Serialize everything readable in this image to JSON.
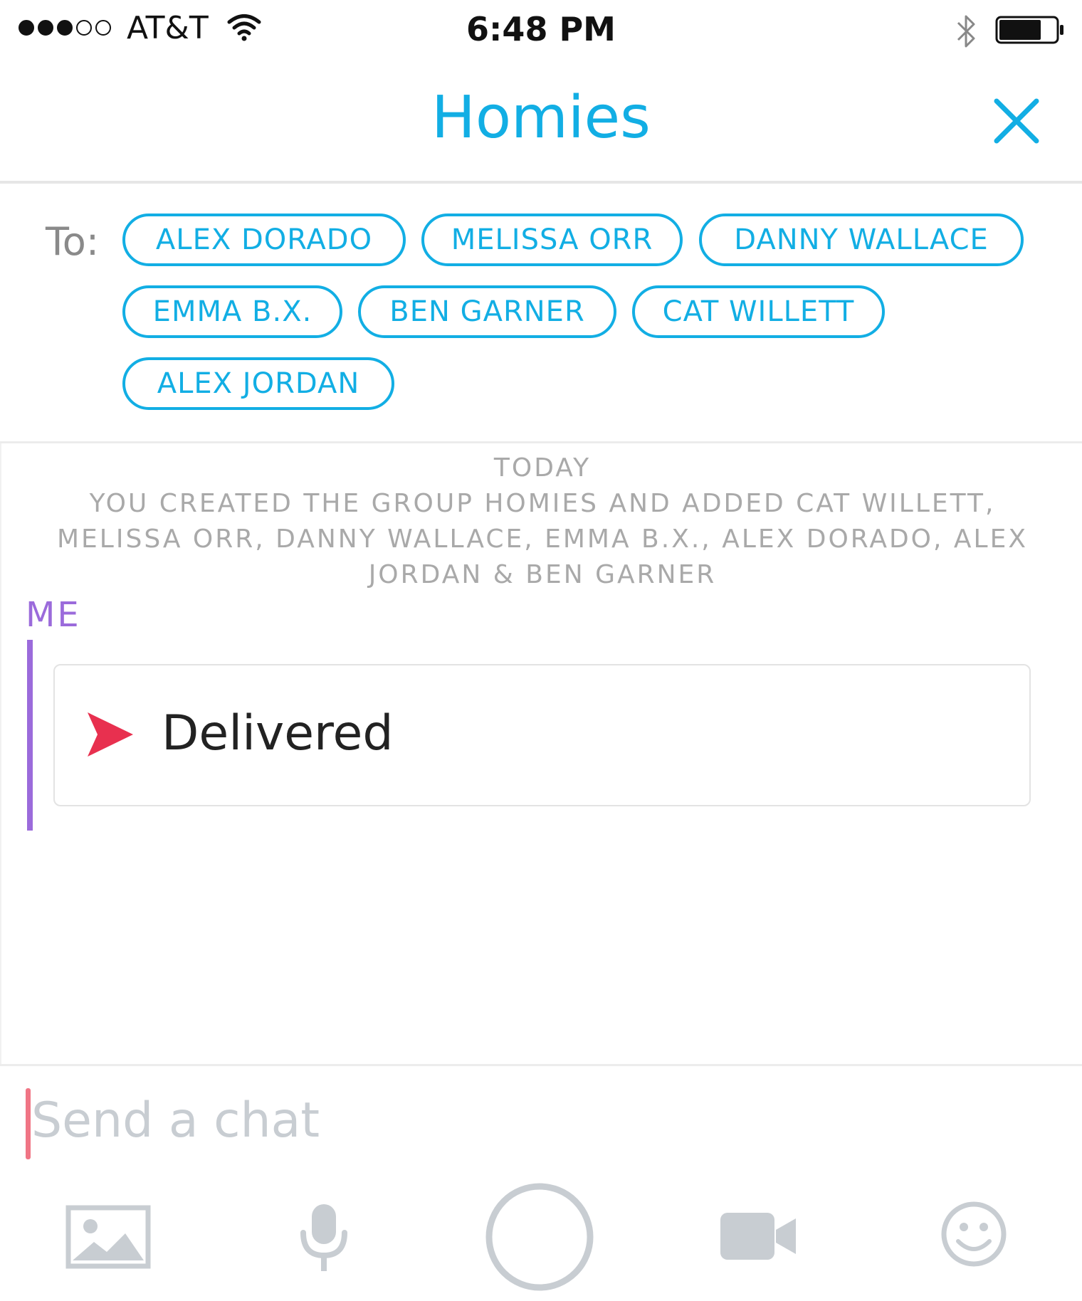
{
  "status_bar": {
    "carrier": "AT&T",
    "time": "6:48 PM",
    "signal_strength": 3,
    "signal_max": 5
  },
  "header": {
    "title": "Homies",
    "close_icon": "close-icon"
  },
  "recipients": {
    "label": "To:",
    "chips": [
      "ALEX DORADO",
      "MELISSA ORR",
      "DANNY WALLACE",
      "EMMA B.X.",
      "BEN GARNER",
      "CAT WILLETT",
      "ALEX JORDAN"
    ]
  },
  "chat": {
    "system_message": {
      "line1": "TODAY",
      "line2": "YOU CREATED THE GROUP HOMIES AND ADDED CAT WILLETT,",
      "line3": "MELISSA ORR, DANNY WALLACE, EMMA B.X., ALEX DORADO, ALEX",
      "line4": "JORDAN & BEN GARNER"
    },
    "sender": "ME",
    "message_status": "Delivered"
  },
  "composer": {
    "placeholder": "Send a chat",
    "toolbar_icons": [
      "image-icon",
      "microphone-icon",
      "capture-button",
      "video-icon",
      "emoji-icon"
    ]
  },
  "colors": {
    "accent_blue": "#12aee4",
    "me_purple": "#9b6bdb",
    "delivered_red": "#e8304f",
    "toolbar_gray": "#c8cdd2"
  }
}
